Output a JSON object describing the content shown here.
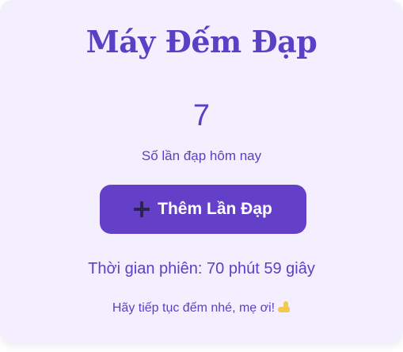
{
  "app": {
    "title": "Máy Đếm Đạp"
  },
  "counter": {
    "value": "7",
    "label": "Số lần đạp hôm nay"
  },
  "add_button": {
    "icon": "plus-icon",
    "label": "Thêm Lần Đạp"
  },
  "session": {
    "text": "Thời gian phiên: 70 phút 59 giây"
  },
  "encouragement": {
    "text": "Hãy tiếp tục đếm nhé, mẹ ơi!",
    "icon": "foot-icon"
  },
  "colors": {
    "accent": "#5b3fc4",
    "button": "#6440c8",
    "card_background": "#f3effe"
  }
}
